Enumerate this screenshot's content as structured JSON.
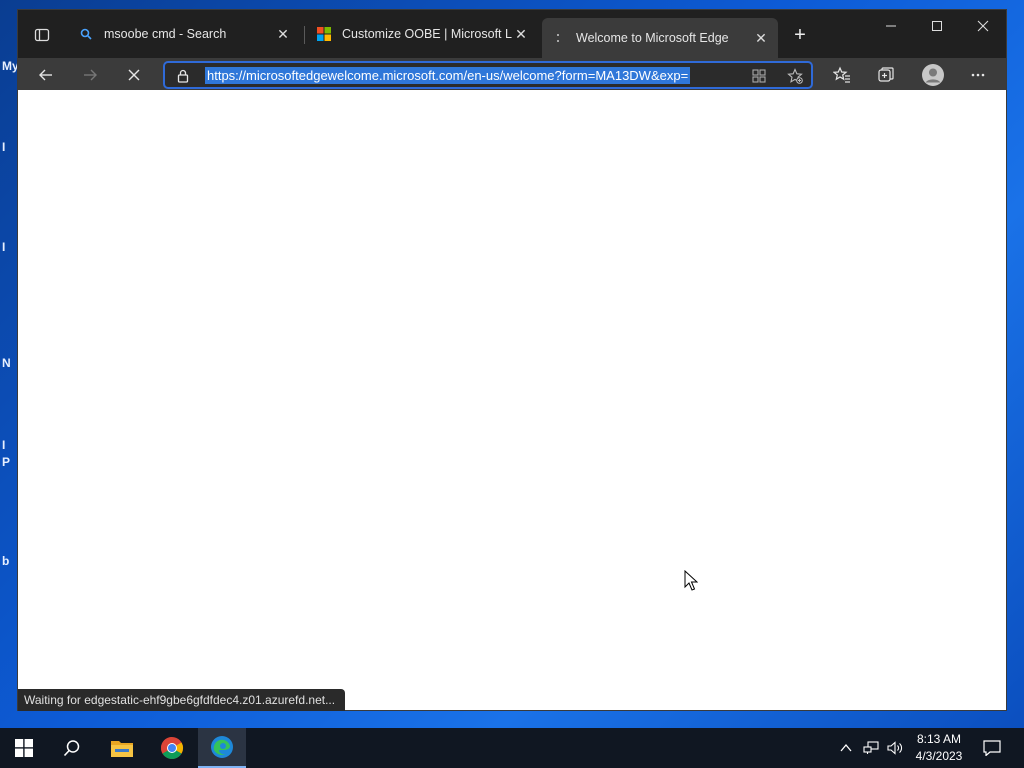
{
  "desktop": {
    "glyphs": [
      "My",
      "I",
      "I",
      "N",
      "I",
      "P",
      "b"
    ]
  },
  "browser": {
    "tabs": [
      {
        "title": "msoobe cmd - Search",
        "favicon": "search-icon"
      },
      {
        "title": "Customize OOBE | Microsoft Learn",
        "favicon": "microsoft-logo-icon"
      },
      {
        "title": "Welcome to Microsoft Edge",
        "favicon": "loading-icon",
        "active": true
      }
    ],
    "tab_close": "✕",
    "new_tab": "+",
    "window_controls": {
      "minimize": "—",
      "maximize": "☐",
      "close": "✕"
    },
    "address": {
      "url": "https://microsoftedgewelcome.microsoft.com/en-us/welcome?form=MA13DW&exp="
    },
    "status": "Waiting for edgestatic-ehf9gbe6gfdfdec4.z01.azurefd.net..."
  },
  "taskbar": {
    "time": "8:13 AM",
    "date": "4/3/2023",
    "apps": [
      "start",
      "search",
      "file-explorer",
      "chrome",
      "edge"
    ]
  },
  "colors": {
    "tabstrip": "#202020",
    "toolbar": "#3b3b3b",
    "accent": "#2f6ad8",
    "taskbar": "#101722"
  }
}
